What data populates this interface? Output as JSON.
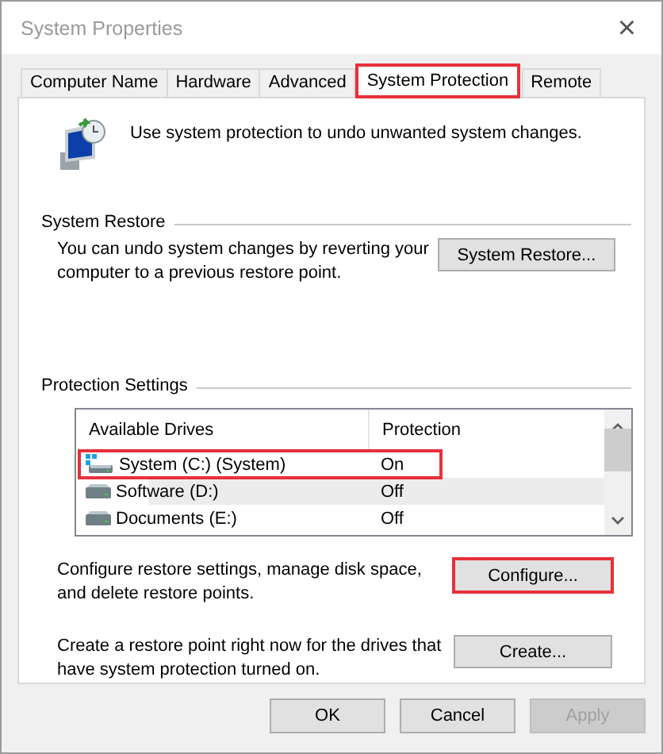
{
  "window": {
    "title": "System Properties",
    "close": "×"
  },
  "tabs": [
    {
      "label": "Computer Name",
      "selected": false,
      "highlighted": false
    },
    {
      "label": "Hardware",
      "selected": false,
      "highlighted": false
    },
    {
      "label": "Advanced",
      "selected": false,
      "highlighted": false
    },
    {
      "label": "System Protection",
      "selected": true,
      "highlighted": true
    },
    {
      "label": "Remote",
      "selected": false,
      "highlighted": false
    }
  ],
  "intro": "Use system protection to undo unwanted system changes.",
  "system_restore": {
    "heading": "System Restore",
    "description": "You can undo system changes by reverting your computer to a previous restore point.",
    "button": {
      "label": "System Restore...",
      "disabled": false,
      "highlighted": false
    }
  },
  "protection_settings": {
    "heading": "Protection Settings",
    "columns": [
      "Available Drives",
      "Protection"
    ],
    "drives": [
      {
        "name": "System (C:) (System)",
        "protection": "On",
        "kind": "system",
        "hovered": false,
        "highlighted": true
      },
      {
        "name": "Software (D:)",
        "protection": "Off",
        "kind": "local",
        "hovered": true,
        "highlighted": false
      },
      {
        "name": "Documents (E:)",
        "protection": "Off",
        "kind": "local",
        "hovered": false,
        "highlighted": false
      }
    ],
    "actions": [
      {
        "description": "Configure restore settings, manage disk space, and delete restore points.",
        "button": {
          "label": "Configure...",
          "disabled": false,
          "highlighted": true
        }
      },
      {
        "description": "Create a restore point right now for the drives that have system protection turned on.",
        "button": {
          "label": "Create...",
          "disabled": false,
          "highlighted": false
        }
      }
    ]
  },
  "buttons": [
    {
      "label": "OK",
      "disabled": false,
      "highlighted": false
    },
    {
      "label": "Cancel",
      "disabled": false,
      "highlighted": false
    },
    {
      "label": "Apply",
      "disabled": true,
      "highlighted": false
    }
  ]
}
